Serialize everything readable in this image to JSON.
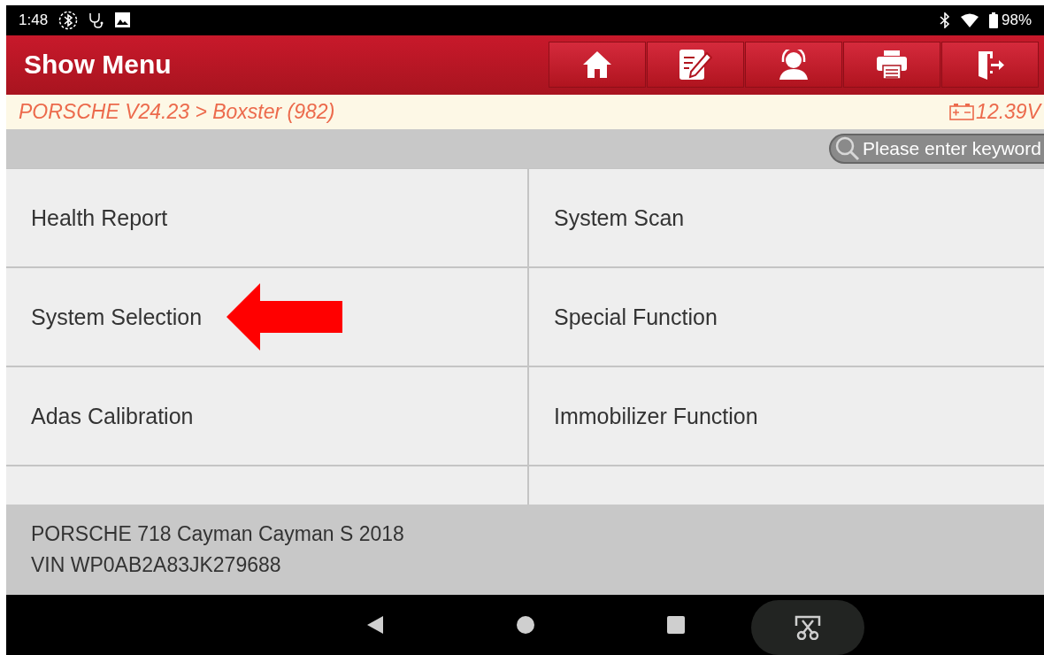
{
  "status_bar": {
    "time": "1:48",
    "battery": "98%"
  },
  "header": {
    "title": "Show Menu",
    "tools": [
      {
        "kind": "home"
      },
      {
        "kind": "edit"
      },
      {
        "kind": "support"
      },
      {
        "kind": "print"
      },
      {
        "kind": "exit"
      }
    ]
  },
  "breadcrumb": {
    "path": "PORSCHE V24.23 > Boxster (982)",
    "voltage": "12.39V"
  },
  "search": {
    "placeholder": "Please enter keyword"
  },
  "menu_items": [
    {
      "label": "Health Report",
      "annotated": false
    },
    {
      "label": "System Scan",
      "annotated": false
    },
    {
      "label": "System Selection",
      "annotated": true
    },
    {
      "label": "Special Function",
      "annotated": false
    },
    {
      "label": "Adas Calibration",
      "annotated": false
    },
    {
      "label": "Immobilizer Function",
      "annotated": false
    }
  ],
  "vehicle": {
    "model": "PORSCHE 718 Cayman Cayman S 2018",
    "vin": "VIN WP0AB2A83JK279688"
  },
  "nav_bar": [
    {
      "kind": "back"
    },
    {
      "kind": "home"
    },
    {
      "kind": "recents"
    },
    {
      "kind": "screenshot"
    }
  ]
}
